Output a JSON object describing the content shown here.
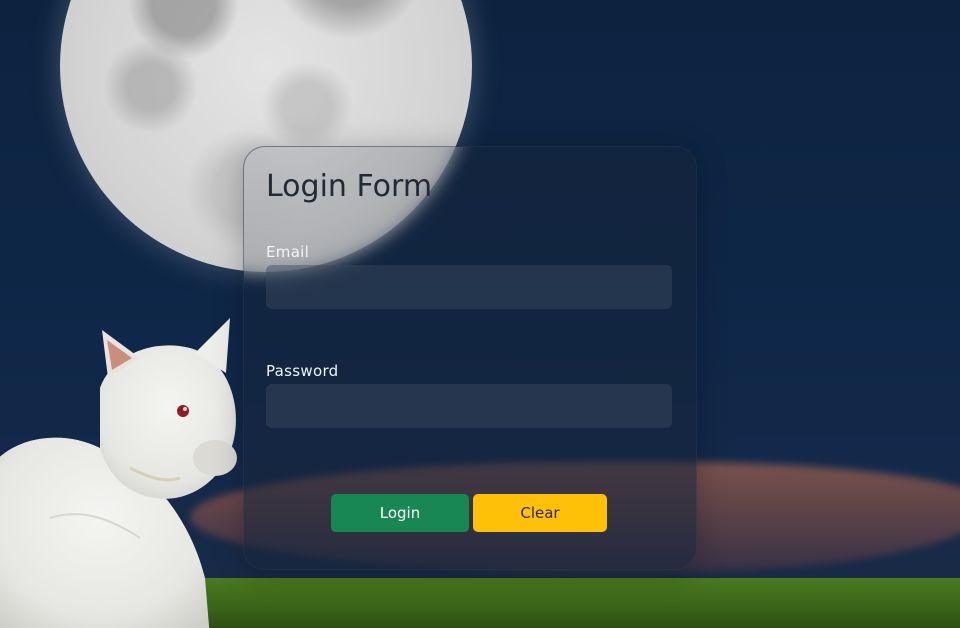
{
  "form": {
    "title": "Login Form",
    "email_label": "Email",
    "email_value": "",
    "password_label": "Password",
    "password_value": "",
    "login_label": "Login",
    "clear_label": "Clear"
  },
  "colors": {
    "login_button": "#198754",
    "clear_button": "#ffc107",
    "sky": "#0c2340"
  }
}
